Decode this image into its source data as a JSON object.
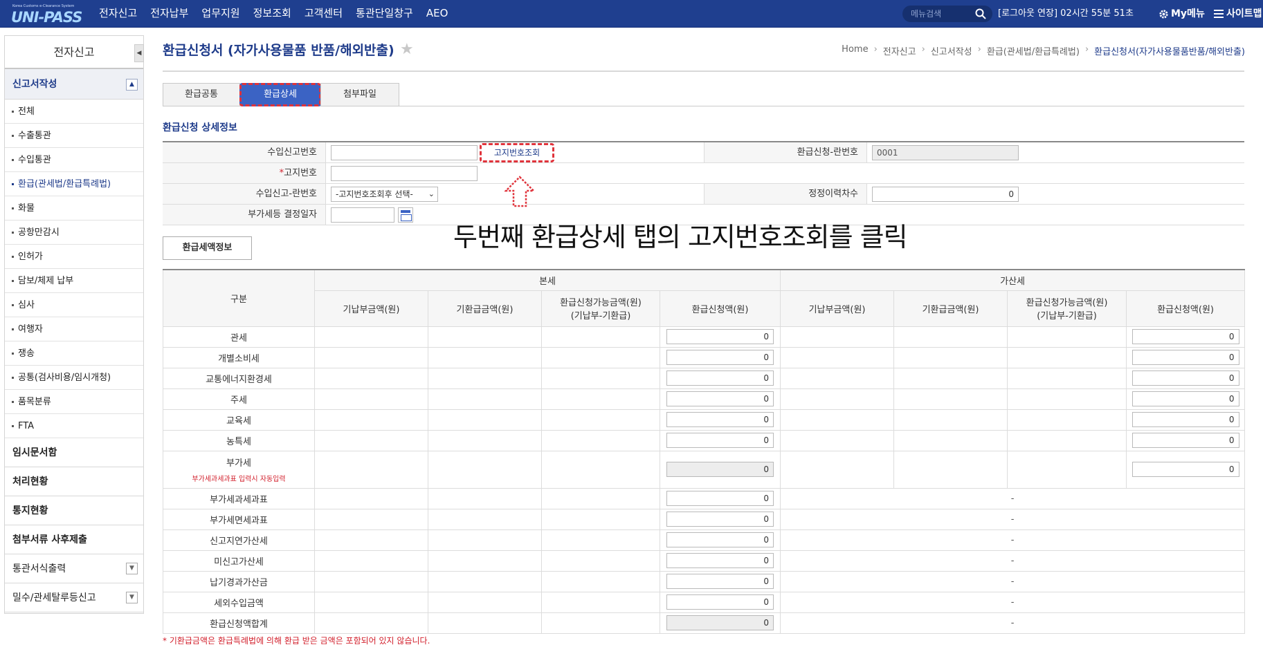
{
  "header": {
    "logo_sub": "Korea Customs e-Clearance System",
    "logo_main": "UNI-PASS",
    "menu": [
      "전자신고",
      "전자납부",
      "업무지원",
      "정보조회",
      "고객센터",
      "통관단일창구",
      "AEO"
    ],
    "search_placeholder": "메뉴검색",
    "session": "[로그아웃 연장] 02시간 55분 51초",
    "my_menu": "My메뉴",
    "sitemap": "사이트맵"
  },
  "sidebar": {
    "title": "전자신고",
    "section": "신고서작성",
    "items": [
      "전체",
      "수출통관",
      "수입통관",
      "환급(관세법/환급특례법)",
      "화물",
      "공항만감시",
      "인허가",
      "담보/체제 납부",
      "심사",
      "여행자",
      "쟁송",
      "공통(검사비용/임시개청)",
      "품목분류",
      "FTA"
    ],
    "active_index": 3,
    "groups": [
      "임시문서함",
      "처리현황",
      "통지현황",
      "첨부서류 사후제출",
      "통관서식출력",
      "밀수/관세탈루등신고"
    ]
  },
  "page": {
    "title": "환급신청서 (자가사용물품 반품/해외반출)",
    "breadcrumb": [
      "Home",
      "전자신고",
      "신고서작성",
      "환급(관세법/환급특례법)",
      "환급신청서(자가사용물품반품/해외반출)"
    ],
    "tabs": [
      "환급공통",
      "환급상세",
      "첨부파일"
    ],
    "active_tab": 1,
    "section_title": "환급신청 상세정보"
  },
  "form": {
    "import_decl_no_label": "수입신고번호",
    "import_decl_no_value": "",
    "lookup_button": "고지번호조회",
    "refund_line_no_label": "환급신청-란번호",
    "refund_line_no_value": "0001",
    "notice_no_required": "*",
    "notice_no_label": "고지번호",
    "notice_no_value": "",
    "import_line_no_label": "수입신고-란번호",
    "import_line_no_select": "-고지번호조회후 선택-",
    "correction_count_label": "정정이력차수",
    "correction_count_value": "0",
    "vat_date_label": "부가세등 결정일자",
    "vat_date_value": ""
  },
  "annotation": "두번째 환급상세 탭의 고지번호조회를 클릭",
  "amount_button": "환급세액정보",
  "table": {
    "col_category": "구분",
    "group_main": "본세",
    "group_add": "가산세",
    "cols": [
      "기납부금액(원)",
      "기환급금액(원)",
      "환급신청가능금액(원)",
      "(기납부-기환급)",
      "환급신청액(원)"
    ],
    "rows_full": [
      "관세",
      "개별소비세",
      "교통에너지환경세",
      "주세",
      "교육세",
      "농특세"
    ],
    "vat_label": "부가세",
    "vat_note": "부가세과세과표 입력시 자동입력",
    "rows_main_only": [
      "부가세과세과표",
      "부가세면세과표",
      "신고지연가산세",
      "미신고가산세",
      "납기경과가산금",
      "세외수입금액"
    ],
    "total_label": "환급신청액합계",
    "zero": "0",
    "dash": "-"
  },
  "footnote": "* 기환급금액은 환급특례법에 의해 환급 받은 금액은 포함되어 있지 않습니다."
}
